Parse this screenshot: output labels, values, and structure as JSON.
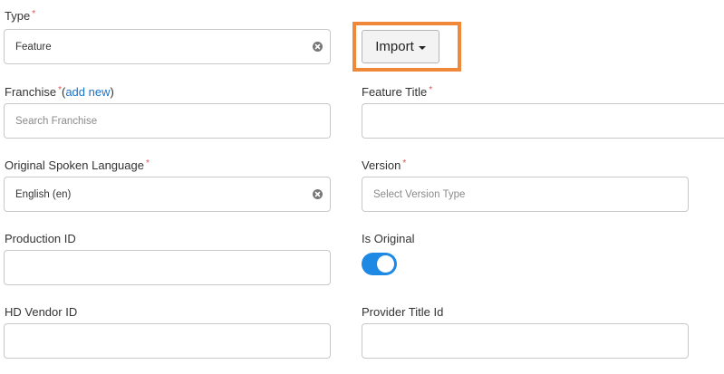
{
  "type": {
    "label": "Type",
    "value": "Feature"
  },
  "import_button": {
    "label": "Import"
  },
  "franchise": {
    "label": "Franchise",
    "add_new_text": "add new",
    "placeholder": "Search Franchise"
  },
  "feature_title": {
    "label": "Feature Title",
    "value": ""
  },
  "original_spoken_language": {
    "label": "Original Spoken Language",
    "value": "English (en)"
  },
  "version": {
    "label": "Version",
    "placeholder": "Select Version Type"
  },
  "production_id": {
    "label": "Production ID",
    "value": ""
  },
  "is_original": {
    "label": "Is Original",
    "checked": true
  },
  "hd_vendor_id": {
    "label": "HD Vendor ID",
    "value": ""
  },
  "provider_title_id": {
    "label": "Provider Title Id",
    "value": ""
  },
  "colors": {
    "required": "#d9534f",
    "toggle_on": "#1e88e5",
    "highlight": "#f0883a",
    "link": "#1a73c8"
  },
  "icons": {
    "clear": "clear-icon",
    "dropdown": "caret-down-icon"
  }
}
